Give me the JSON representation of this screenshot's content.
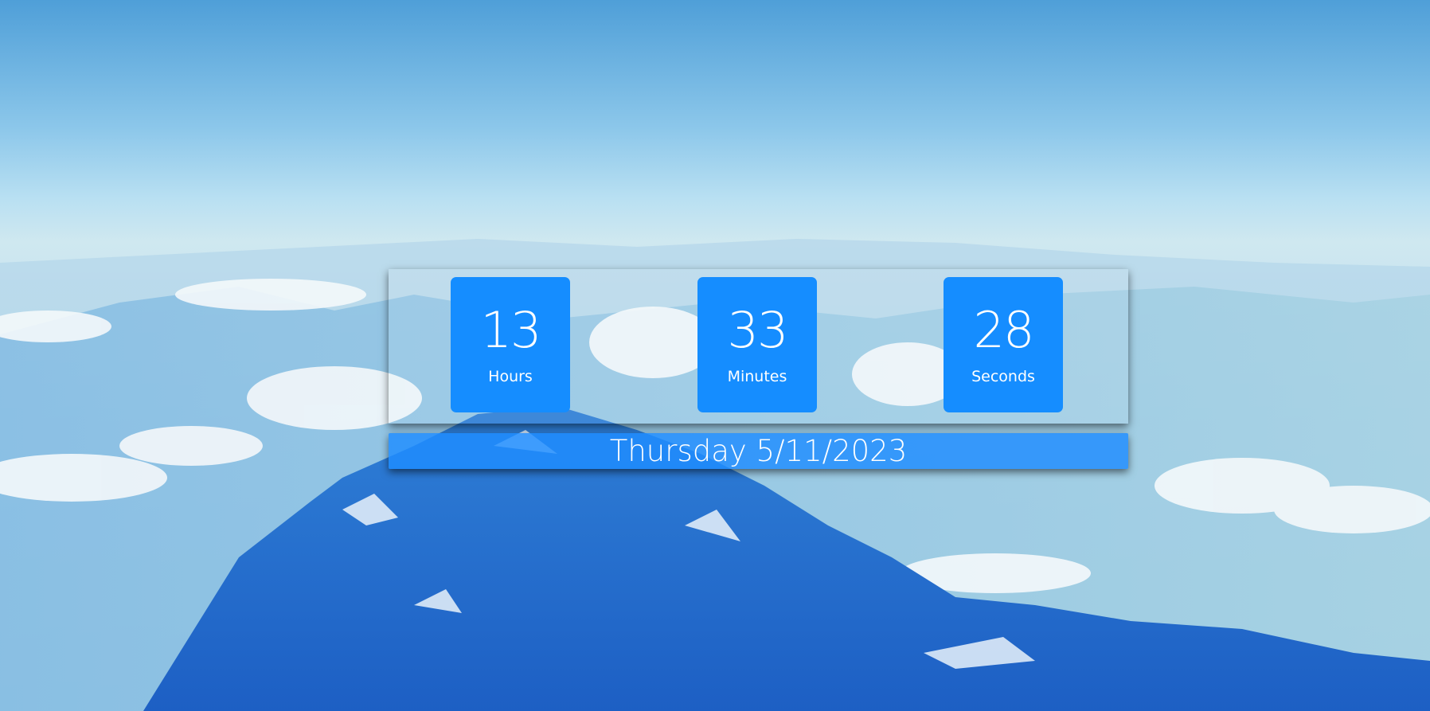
{
  "clock": {
    "hours": {
      "value": "13",
      "label": "Hours"
    },
    "minutes": {
      "value": "33",
      "label": "Minutes"
    },
    "seconds": {
      "value": "28",
      "label": "Seconds"
    }
  },
  "date": {
    "text": "Thursday 5/11/2023"
  },
  "colors": {
    "box": "#158dff",
    "date_bar": "#1e8cff"
  }
}
